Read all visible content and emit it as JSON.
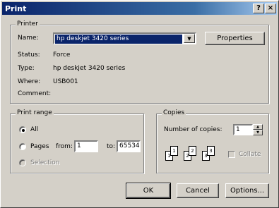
{
  "window": {
    "title": "Print",
    "help_button": "?",
    "close_button": "×"
  },
  "printer": {
    "group_label": "Printer",
    "name_label": "Name:",
    "name_value": "hp deskjet 3420 series",
    "properties_button": "Properties",
    "status_label": "Status:",
    "status_value": "Force",
    "type_label": "Type:",
    "type_value": "hp deskjet 3420 series",
    "where_label": "Where:",
    "where_value": "USB001",
    "comment_label": "Comment:"
  },
  "print_range": {
    "group_label": "Print range",
    "all_label": "All",
    "pages_label": "Pages",
    "from_label": "from:",
    "from_value": "1",
    "to_label": "to:",
    "to_value": "65534",
    "selection_label": "Selection",
    "selected": "all"
  },
  "copies": {
    "group_label": "Copies",
    "number_label": "Number of copies:",
    "number_value": "1",
    "collate_label": "Collate",
    "page_icons": [
      "1",
      "1",
      "2",
      "2",
      "3",
      "3"
    ]
  },
  "footer": {
    "ok_label": "OK",
    "cancel_label": "Cancel",
    "options_label": "Options..."
  }
}
